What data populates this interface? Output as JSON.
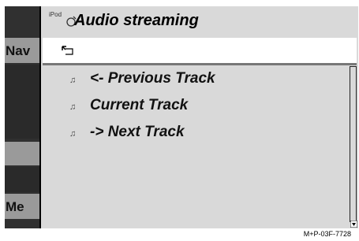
{
  "background_menu": {
    "nav_label": "Nav",
    "media_label": "Me"
  },
  "popup": {
    "ipod_label": "iPod",
    "title": "Audio streaming",
    "items": [
      {
        "icon": "music-note-icon",
        "label": "<- Previous Track"
      },
      {
        "icon": "music-note-icon",
        "label": "Current Track"
      },
      {
        "icon": "music-note-icon",
        "label": "-> Next Track"
      }
    ]
  },
  "caption": "M+P-03F-7728"
}
